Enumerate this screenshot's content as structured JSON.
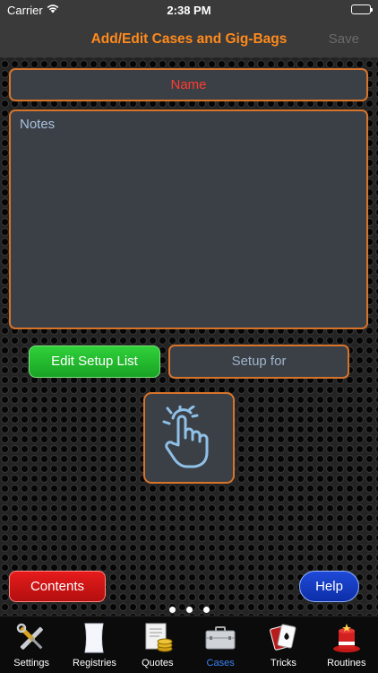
{
  "status": {
    "carrier": "Carrier",
    "time": "2:38 PM"
  },
  "nav": {
    "title": "Add/Edit Cases and Gig-Bags",
    "save": "Save"
  },
  "form": {
    "name_placeholder": "Name",
    "notes_placeholder": "Notes",
    "edit_setup_label": "Edit Setup List",
    "setup_for_label": "Setup for"
  },
  "actions": {
    "contents": "Contents",
    "help": "Help"
  },
  "tabs": [
    {
      "label": "Settings",
      "icon": "tools-icon"
    },
    {
      "label": "Registries",
      "icon": "paper-icon"
    },
    {
      "label": "Quotes",
      "icon": "coins-icon"
    },
    {
      "label": "Cases",
      "icon": "briefcase-icon",
      "active": true
    },
    {
      "label": "Tricks",
      "icon": "cards-icon"
    },
    {
      "label": "Routines",
      "icon": "magic-hat-icon"
    }
  ],
  "colors": {
    "accent": "#ff8a1c",
    "field_border": "#d8742a",
    "field_bg": "#3b4046"
  }
}
